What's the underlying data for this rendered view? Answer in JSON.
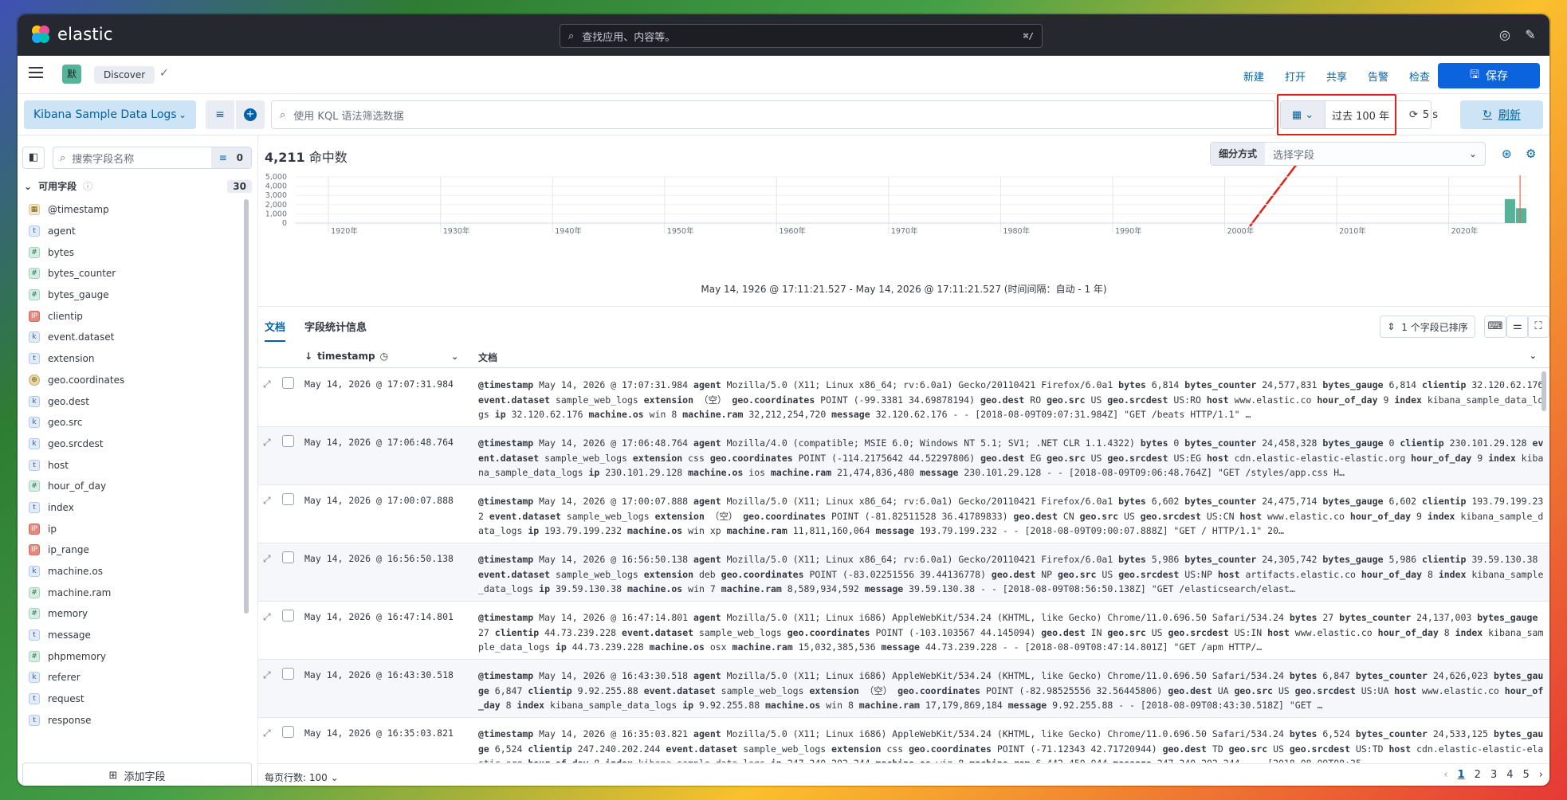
{
  "app": {
    "brand": "elastic",
    "brand_colors": [
      "#f04e98",
      "#fec514",
      "#00bfb3",
      "#1ba9f5"
    ]
  },
  "global_search": {
    "placeholder": "查找应用、内容等。",
    "shortcut": "⌘/"
  },
  "subbar": {
    "space_initial": "默",
    "breadcrumb": "Discover",
    "links": [
      "新建",
      "打开",
      "共享",
      "告警",
      "检查"
    ],
    "save_label": "保存"
  },
  "querybar": {
    "data_view": "Kibana Sample Data Logs",
    "kql_placeholder": "使用 KQL 语法筛选数据",
    "date_range": "过去 100 年",
    "refresh_interval": "5 s",
    "refresh_label": "刷新"
  },
  "sidebar": {
    "search_placeholder": "搜索字段名称",
    "filter_count": "0",
    "section_label": "可用字段",
    "section_count": "30",
    "fields": [
      {
        "name": "@timestamp",
        "type": "date",
        "glyph": "▦"
      },
      {
        "name": "agent",
        "type": "txt",
        "glyph": "t"
      },
      {
        "name": "bytes",
        "type": "num",
        "glyph": "#"
      },
      {
        "name": "bytes_counter",
        "type": "num",
        "glyph": "#"
      },
      {
        "name": "bytes_gauge",
        "type": "num",
        "glyph": "#"
      },
      {
        "name": "clientip",
        "type": "ip",
        "glyph": "IP"
      },
      {
        "name": "event.dataset",
        "type": "kw",
        "glyph": "k"
      },
      {
        "name": "extension",
        "type": "txt",
        "glyph": "t"
      },
      {
        "name": "geo.coordinates",
        "type": "geo",
        "glyph": "⊕"
      },
      {
        "name": "geo.dest",
        "type": "kw",
        "glyph": "k"
      },
      {
        "name": "geo.src",
        "type": "kw",
        "glyph": "k"
      },
      {
        "name": "geo.srcdest",
        "type": "kw",
        "glyph": "k"
      },
      {
        "name": "host",
        "type": "txt",
        "glyph": "t"
      },
      {
        "name": "hour_of_day",
        "type": "num",
        "glyph": "#"
      },
      {
        "name": "index",
        "type": "txt",
        "glyph": "t"
      },
      {
        "name": "ip",
        "type": "ip",
        "glyph": "IP"
      },
      {
        "name": "ip_range",
        "type": "ip",
        "glyph": "IP"
      },
      {
        "name": "machine.os",
        "type": "kw",
        "glyph": "k"
      },
      {
        "name": "machine.ram",
        "type": "num",
        "glyph": "#"
      },
      {
        "name": "memory",
        "type": "num",
        "glyph": "#"
      },
      {
        "name": "message",
        "type": "txt",
        "glyph": "t"
      },
      {
        "name": "phpmemory",
        "type": "num",
        "glyph": "#"
      },
      {
        "name": "referer",
        "type": "kw",
        "glyph": "k"
      },
      {
        "name": "request",
        "type": "txt",
        "glyph": "t"
      },
      {
        "name": "response",
        "type": "txt",
        "glyph": "t"
      }
    ],
    "add_field_label": "添加字段"
  },
  "main": {
    "hits_count": "4,211",
    "hits_label": "命中数",
    "breakdown_label": "细分方式",
    "breakdown_placeholder": "选择字段",
    "time_caption": "May 14, 1926 @ 17:11:21.527 - May 14, 2026 @ 17:11:21.527  (时间间隔：自动 - 1 年)",
    "tabs": [
      "文档",
      "字段统计信息"
    ],
    "sort_label": "1 个字段已排序",
    "columns": {
      "timestamp": "timestamp",
      "document": "文档"
    },
    "rows_per_page": "每页行数: 100",
    "pages": [
      "1",
      "2",
      "3",
      "4",
      "5"
    ]
  },
  "chart_data": {
    "type": "bar",
    "title": "",
    "xlabel": "",
    "ylabel": "",
    "ylim": [
      0,
      5000
    ],
    "yticks": [
      "5,000",
      "4,000",
      "3,000",
      "2,000",
      "1,000",
      "0"
    ],
    "x_ticks": [
      "1920年",
      "1930年",
      "1940年",
      "1950年",
      "1960年",
      "1970年",
      "1980年",
      "1990年",
      "2000年",
      "2010年",
      "2020年"
    ],
    "x_range": [
      1917,
      2027
    ],
    "categories": [
      "2025",
      "2026"
    ],
    "values": [
      2600,
      1611
    ],
    "color": "#54b399",
    "now_marker_color": "#e7664c",
    "grid": true
  },
  "rows": [
    {
      "ts": "May 14, 2026 @ 17:07:31.984",
      "fields": [
        [
          "@timestamp",
          "May 14, 2026 @ 17:07:31.984"
        ],
        [
          "agent",
          "Mozilla/5.0 (X11; Linux x86_64; rv:6.0a1) Gecko/20110421 Firefox/6.0a1"
        ],
        [
          "bytes",
          "6,814"
        ],
        [
          "bytes_counter",
          "24,577,831"
        ],
        [
          "bytes_gauge",
          "6,814"
        ],
        [
          "clientip",
          "32.120.62.176"
        ],
        [
          "event.dataset",
          "sample_web_logs"
        ],
        [
          "extension",
          "（空）"
        ],
        [
          "geo.coordinates",
          "POINT (-99.3381 34.69878194)"
        ],
        [
          "geo.dest",
          "RO"
        ],
        [
          "geo.src",
          "US"
        ],
        [
          "geo.srcdest",
          "US:RO"
        ],
        [
          "host",
          "www.elastic.co"
        ],
        [
          "hour_of_day",
          "9"
        ],
        [
          "index",
          "kibana_sample_data_logs"
        ],
        [
          "ip",
          "32.120.62.176"
        ],
        [
          "machine.os",
          "win 8"
        ],
        [
          "machine.ram",
          "32,212,254,720"
        ],
        [
          "message",
          "32.120.62.176 - - [2018-08-09T09:07:31.984Z] \"GET /beats HTTP/1.1\" …"
        ]
      ]
    },
    {
      "ts": "May 14, 2026 @ 17:06:48.764",
      "fields": [
        [
          "@timestamp",
          "May 14, 2026 @ 17:06:48.764"
        ],
        [
          "agent",
          "Mozilla/4.0 (compatible; MSIE 6.0; Windows NT 5.1; SV1; .NET CLR 1.1.4322)"
        ],
        [
          "bytes",
          "0"
        ],
        [
          "bytes_counter",
          "24,458,328"
        ],
        [
          "bytes_gauge",
          "0"
        ],
        [
          "clientip",
          "230.101.29.128"
        ],
        [
          "event.dataset",
          "sample_web_logs"
        ],
        [
          "extension",
          "css"
        ],
        [
          "geo.coordinates",
          "POINT (-114.2175642 44.52297806)"
        ],
        [
          "geo.dest",
          "EG"
        ],
        [
          "geo.src",
          "US"
        ],
        [
          "geo.srcdest",
          "US:EG"
        ],
        [
          "host",
          "cdn.elastic-elastic-elastic.org"
        ],
        [
          "hour_of_day",
          "9"
        ],
        [
          "index",
          "kibana_sample_data_logs"
        ],
        [
          "ip",
          "230.101.29.128"
        ],
        [
          "machine.os",
          "ios"
        ],
        [
          "machine.ram",
          "21,474,836,480"
        ],
        [
          "message",
          "230.101.29.128 - - [2018-08-09T09:06:48.764Z] \"GET /styles/app.css H…"
        ]
      ]
    },
    {
      "ts": "May 14, 2026 @ 17:00:07.888",
      "fields": [
        [
          "@timestamp",
          "May 14, 2026 @ 17:00:07.888"
        ],
        [
          "agent",
          "Mozilla/5.0 (X11; Linux x86_64; rv:6.0a1) Gecko/20110421 Firefox/6.0a1"
        ],
        [
          "bytes",
          "6,602"
        ],
        [
          "bytes_counter",
          "24,475,714"
        ],
        [
          "bytes_gauge",
          "6,602"
        ],
        [
          "clientip",
          "193.79.199.232"
        ],
        [
          "event.dataset",
          "sample_web_logs"
        ],
        [
          "extension",
          "（空）"
        ],
        [
          "geo.coordinates",
          "POINT (-81.82511528 36.41789833)"
        ],
        [
          "geo.dest",
          "CN"
        ],
        [
          "geo.src",
          "US"
        ],
        [
          "geo.srcdest",
          "US:CN"
        ],
        [
          "host",
          "www.elastic.co"
        ],
        [
          "hour_of_day",
          "9"
        ],
        [
          "index",
          "kibana_sample_data_logs"
        ],
        [
          "ip",
          "193.79.199.232"
        ],
        [
          "machine.os",
          "win xp"
        ],
        [
          "machine.ram",
          "11,811,160,064"
        ],
        [
          "message",
          "193.79.199.232 - - [2018-08-09T09:00:07.888Z] \"GET / HTTP/1.1\" 20…"
        ]
      ]
    },
    {
      "ts": "May 14, 2026 @ 16:56:50.138",
      "fields": [
        [
          "@timestamp",
          "May 14, 2026 @ 16:56:50.138"
        ],
        [
          "agent",
          "Mozilla/5.0 (X11; Linux x86_64; rv:6.0a1) Gecko/20110421 Firefox/6.0a1"
        ],
        [
          "bytes",
          "5,986"
        ],
        [
          "bytes_counter",
          "24,305,742"
        ],
        [
          "bytes_gauge",
          "5,986"
        ],
        [
          "clientip",
          "39.59.130.38"
        ],
        [
          "event.dataset",
          "sample_web_logs"
        ],
        [
          "extension",
          "deb"
        ],
        [
          "geo.coordinates",
          "POINT (-83.02251556 39.44136778)"
        ],
        [
          "geo.dest",
          "NP"
        ],
        [
          "geo.src",
          "US"
        ],
        [
          "geo.srcdest",
          "US:NP"
        ],
        [
          "host",
          "artifacts.elastic.co"
        ],
        [
          "hour_of_day",
          "8"
        ],
        [
          "index",
          "kibana_sample_data_logs"
        ],
        [
          "ip",
          "39.59.130.38"
        ],
        [
          "machine.os",
          "win 7"
        ],
        [
          "machine.ram",
          "8,589,934,592"
        ],
        [
          "message",
          "39.59.130.38 - - [2018-08-09T08:56:50.138Z] \"GET /elasticsearch/elast…"
        ]
      ]
    },
    {
      "ts": "May 14, 2026 @ 16:47:14.801",
      "fields": [
        [
          "@timestamp",
          "May 14, 2026 @ 16:47:14.801"
        ],
        [
          "agent",
          "Mozilla/5.0 (X11; Linux i686) AppleWebKit/534.24 (KHTML, like Gecko) Chrome/11.0.696.50 Safari/534.24"
        ],
        [
          "bytes",
          "27"
        ],
        [
          "bytes_counter",
          "24,137,003"
        ],
        [
          "bytes_gauge",
          "27"
        ],
        [
          "clientip",
          "44.73.239.228"
        ],
        [
          "event.dataset",
          "sample_web_logs"
        ],
        [
          "geo.coordinates",
          "POINT (-103.103567 44.145094)"
        ],
        [
          "geo.dest",
          "IN"
        ],
        [
          "geo.src",
          "US"
        ],
        [
          "geo.srcdest",
          "US:IN"
        ],
        [
          "host",
          "www.elastic.co"
        ],
        [
          "hour_of_day",
          "8"
        ],
        [
          "index",
          "kibana_sample_data_logs"
        ],
        [
          "ip",
          "44.73.239.228"
        ],
        [
          "machine.os",
          "osx"
        ],
        [
          "machine.ram",
          "15,032,385,536"
        ],
        [
          "message",
          "44.73.239.228 - - [2018-08-09T08:47:14.801Z] \"GET /apm HTTP/…"
        ]
      ]
    },
    {
      "ts": "May 14, 2026 @ 16:43:30.518",
      "fields": [
        [
          "@timestamp",
          "May 14, 2026 @ 16:43:30.518"
        ],
        [
          "agent",
          "Mozilla/5.0 (X11; Linux i686) AppleWebKit/534.24 (KHTML, like Gecko) Chrome/11.0.696.50 Safari/534.24"
        ],
        [
          "bytes",
          "6,847"
        ],
        [
          "bytes_counter",
          "24,626,023"
        ],
        [
          "bytes_gauge",
          "6,847"
        ],
        [
          "clientip",
          "9.92.255.88"
        ],
        [
          "event.dataset",
          "sample_web_logs"
        ],
        [
          "extension",
          "（空）"
        ],
        [
          "geo.coordinates",
          "POINT (-82.98525556 32.56445806)"
        ],
        [
          "geo.dest",
          "UA"
        ],
        [
          "geo.src",
          "US"
        ],
        [
          "geo.srcdest",
          "US:UA"
        ],
        [
          "host",
          "www.elastic.co"
        ],
        [
          "hour_of_day",
          "8"
        ],
        [
          "index",
          "kibana_sample_data_logs"
        ],
        [
          "ip",
          "9.92.255.88"
        ],
        [
          "machine.os",
          "win 8"
        ],
        [
          "machine.ram",
          "17,179,869,184"
        ],
        [
          "message",
          "9.92.255.88 - - [2018-08-09T08:43:30.518Z] \"GET …"
        ]
      ]
    },
    {
      "ts": "May 14, 2026 @ 16:35:03.821",
      "fields": [
        [
          "@timestamp",
          "May 14, 2026 @ 16:35:03.821"
        ],
        [
          "agent",
          "Mozilla/5.0 (X11; Linux i686) AppleWebKit/534.24 (KHTML, like Gecko) Chrome/11.0.696.50 Safari/534.24"
        ],
        [
          "bytes",
          "6,524"
        ],
        [
          "bytes_counter",
          "24,533,125"
        ],
        [
          "bytes_gauge",
          "6,524"
        ],
        [
          "clientip",
          "247.240.202.244"
        ],
        [
          "event.dataset",
          "sample_web_logs"
        ],
        [
          "extension",
          "css"
        ],
        [
          "geo.coordinates",
          "POINT (-71.12343 42.71720944)"
        ],
        [
          "geo.dest",
          "TD"
        ],
        [
          "geo.src",
          "US"
        ],
        [
          "geo.srcdest",
          "US:TD"
        ],
        [
          "host",
          "cdn.elastic-elastic-elastic.org"
        ],
        [
          "hour_of_day",
          "8"
        ],
        [
          "index",
          "kibana_sample_data_logs"
        ],
        [
          "ip",
          "247.240.202.244"
        ],
        [
          "machine.os",
          "win 8"
        ],
        [
          "machine.ram",
          "6,442,450,944"
        ],
        [
          "message",
          "247.240.202.244 - - [2018-08-09T08:35…"
        ]
      ]
    }
  ]
}
